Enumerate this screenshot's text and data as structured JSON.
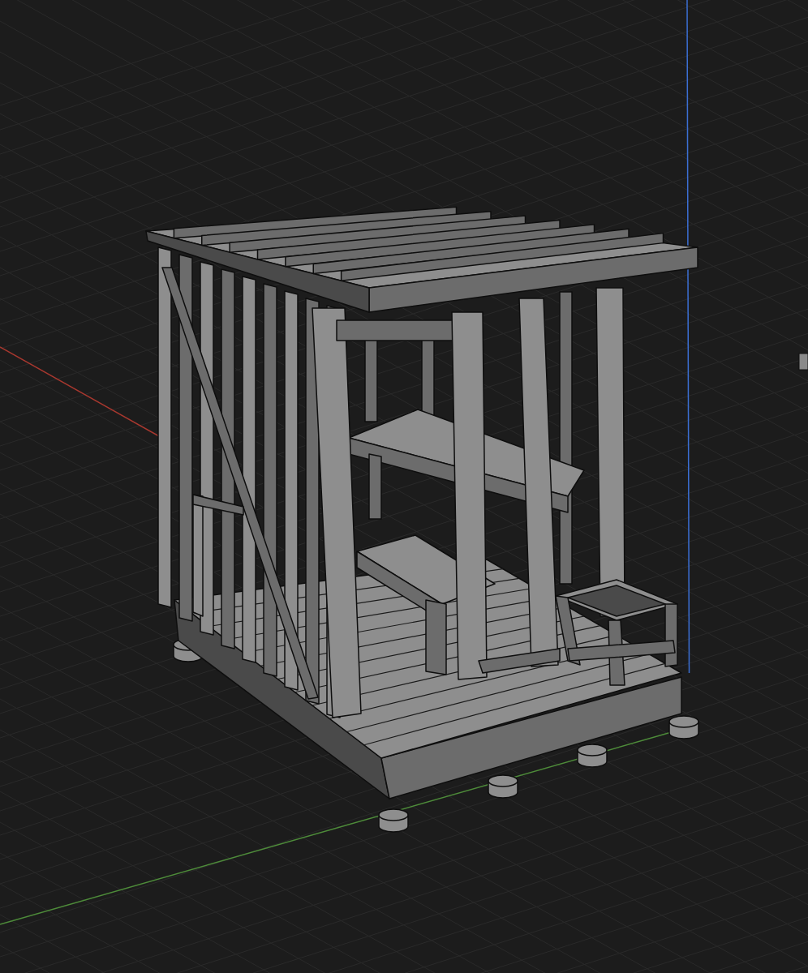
{
  "viewport": {
    "axes": [
      {
        "kind": "x",
        "color": "#a8382f"
      },
      {
        "kind": "y",
        "color": "#4e8c3a"
      },
      {
        "kind": "z",
        "color": "#3b6fd4"
      }
    ]
  }
}
